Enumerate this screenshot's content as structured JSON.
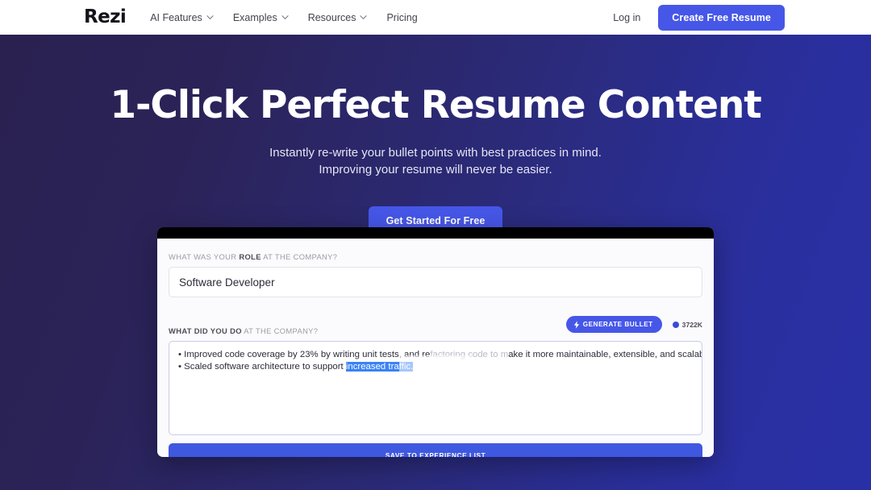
{
  "navbar": {
    "logo": "Rezi",
    "links": [
      {
        "label": "AI Features",
        "has_chevron": true,
        "icon": "chevron-down-icon"
      },
      {
        "label": "Examples",
        "has_chevron": true,
        "icon": "chevron-down-icon"
      },
      {
        "label": "Resources",
        "has_chevron": true,
        "icon": "chevron-down-icon"
      },
      {
        "label": "Pricing",
        "has_chevron": false,
        "icon": ""
      }
    ],
    "login_label": "Log in",
    "create_label": "Create Free Resume"
  },
  "hero": {
    "title": "1-Click Perfect Resume Content",
    "subtitle_line1": "Instantly re-write your bullet points with best practices in mind.",
    "subtitle_line2": "Improving your resume will never be easier.",
    "cta_label": "Get Started For Free"
  },
  "app": {
    "role_label_prefix": "WHAT WAS YOUR ",
    "role_label_bold": "ROLE",
    "role_label_suffix": " AT THE COMPANY?",
    "role_value": "Software Developer",
    "did_label_bold": "WHAT DID YOU DO",
    "did_label_suffix": " AT THE COMPANY?",
    "generate_label": "GENERATE BULLET",
    "generate_icon": "lightning-bolt-icon",
    "credits_value": "3722K",
    "credits_icon": "credit-coin-icon",
    "bullet_line1_pre": "• Improved code coverage by 23% by writing unit tests, and re",
    "bullet_line1_dim": "factoring code to m",
    "bullet_line1_post": "ake it more maintainable, extensible, and scalable.",
    "bullet_line2_pre": "• Scaled software architecture to support ",
    "bullet_line2_selected": "increased traffic.",
    "save_label": "SAVE TO EXPERIENCE LIST",
    "play_icon": "play-button-icon"
  },
  "colors": {
    "brand_blue": "#4657e8",
    "save_blue": "#3f58e0",
    "selection_blue": "#3b82f6",
    "hero_gradient_start": "#2a2150",
    "hero_gradient_end": "#2930a6",
    "titlebar_black": "#000000"
  }
}
